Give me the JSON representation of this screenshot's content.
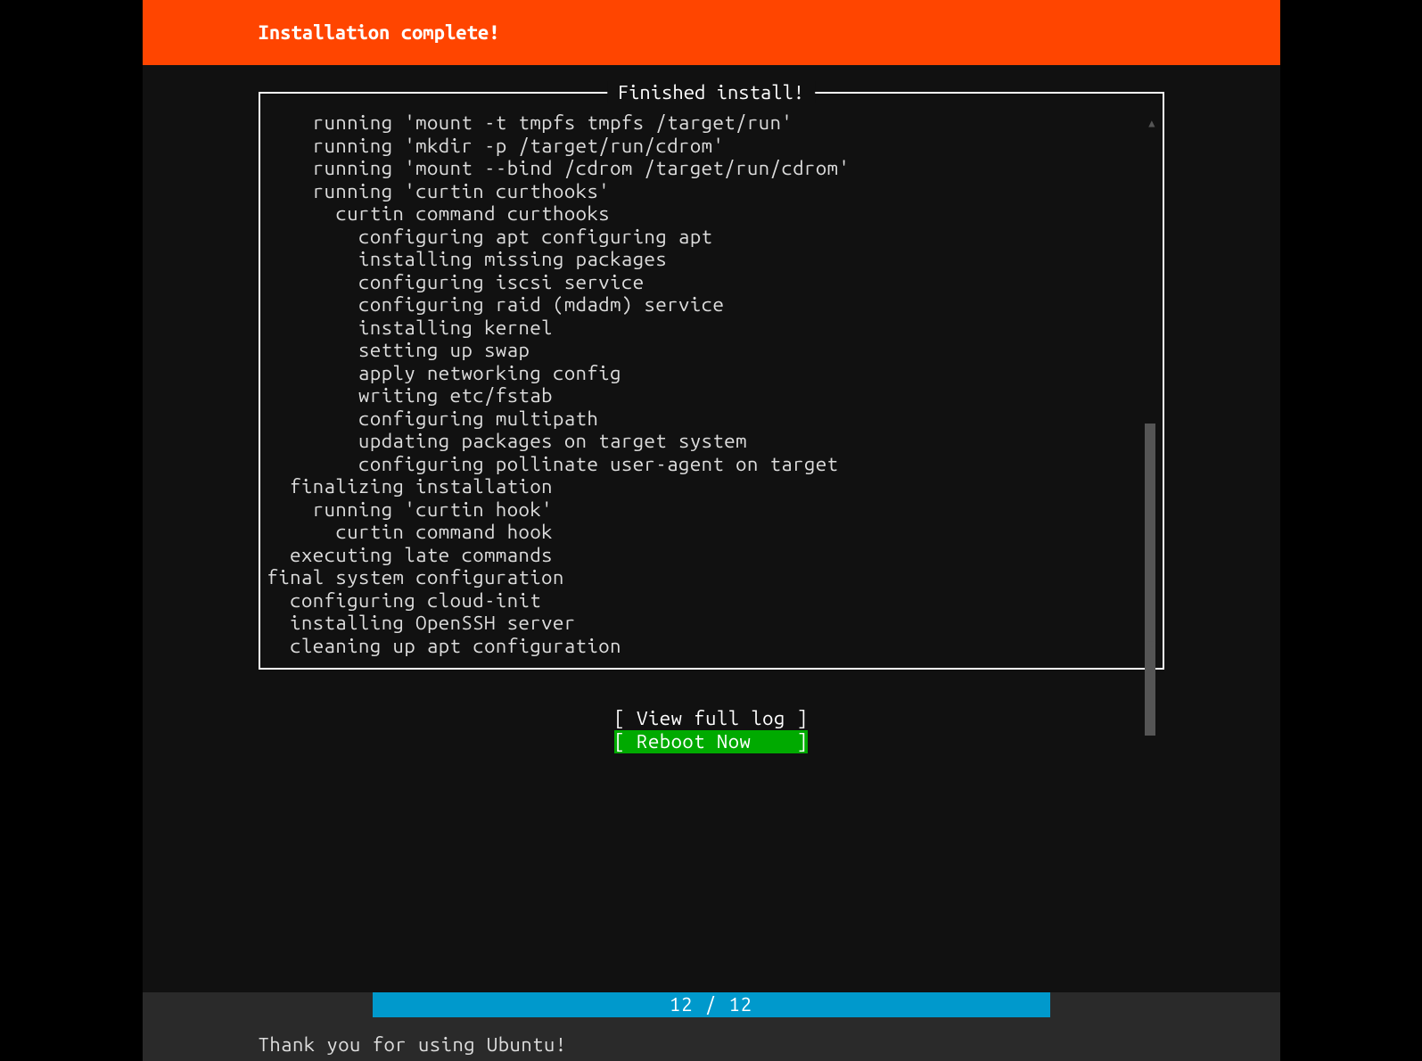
{
  "header": {
    "title": "Installation complete!"
  },
  "frame": {
    "title": "Finished install!"
  },
  "log_lines": [
    "    running 'mount -t tmpfs tmpfs /target/run'",
    "    running 'mkdir -p /target/run/cdrom'",
    "    running 'mount --bind /cdrom /target/run/cdrom'",
    "    running 'curtin curthooks'",
    "      curtin command curthooks",
    "        configuring apt configuring apt",
    "        installing missing packages",
    "        configuring iscsi service",
    "        configuring raid (mdadm) service",
    "        installing kernel",
    "        setting up swap",
    "        apply networking config",
    "        writing etc/fstab",
    "        configuring multipath",
    "        updating packages on target system",
    "        configuring pollinate user-agent on target",
    "  finalizing installation",
    "    running 'curtin hook'",
    "      curtin command hook",
    "  executing late commands",
    "final system configuration",
    "  configuring cloud-init",
    "  installing OpenSSH server",
    "  cleaning up apt configuration"
  ],
  "buttons": {
    "view_log": "[ View full log ]",
    "reboot": "[ Reboot Now    ]"
  },
  "progress": {
    "text": "12 / 12"
  },
  "footer": {
    "text": "Thank you for using Ubuntu!"
  }
}
